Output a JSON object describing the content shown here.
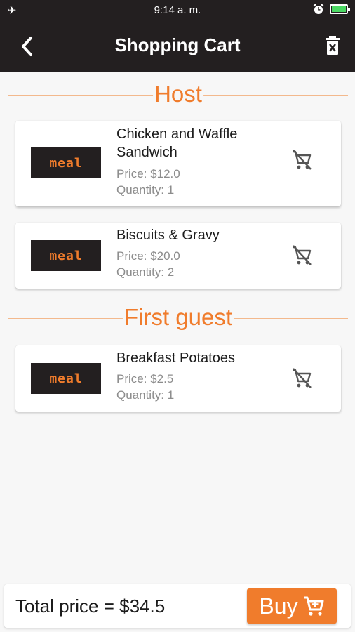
{
  "status_bar": {
    "time": "9:14 a. m."
  },
  "header": {
    "title": "Shopping Cart"
  },
  "sections": [
    {
      "title": "Host",
      "items": [
        {
          "logo_text": "meal",
          "name": "Chicken and Waffle Sandwich",
          "price": "Price: $12.0",
          "quantity": "Quantity: 1"
        },
        {
          "logo_text": "meal",
          "name": "Biscuits & Gravy",
          "price": "Price: $20.0",
          "quantity": "Quantity: 2"
        }
      ]
    },
    {
      "title": "First guest",
      "items": [
        {
          "logo_text": "meal",
          "name": "Breakfast Potatoes",
          "price": "Price: $2.5",
          "quantity": "Quantity: 1"
        }
      ]
    }
  ],
  "footer": {
    "total": "Total price = $34.5",
    "buy_label": "Buy"
  },
  "colors": {
    "accent": "#f07c2c",
    "header_bg": "#231f20",
    "battery": "#4cd964"
  },
  "icons": [
    "airplane-icon",
    "alarm-icon",
    "battery-icon",
    "back-chevron-icon",
    "trash-icon",
    "remove-from-cart-icon",
    "cart-icon"
  ]
}
